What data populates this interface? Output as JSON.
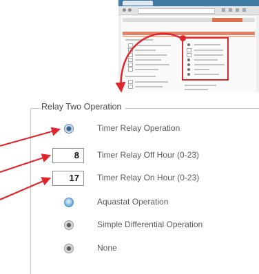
{
  "relay_two": {
    "legend": "Relay Two Operation",
    "options": [
      {
        "label": "Timer Relay Operation",
        "state": "selected"
      },
      {
        "label": "Timer Relay Off Hour (0-23)",
        "value": "8"
      },
      {
        "label": "Timer Relay On Hour (0-23)",
        "value": "17"
      },
      {
        "label": "Aquastat Operation",
        "state": "unselected"
      },
      {
        "label": "Simple Differential Operation",
        "state": "disabled"
      },
      {
        "label": "None",
        "state": "disabled"
      }
    ]
  },
  "colors": {
    "annotation_red": "#e0262d",
    "radio_blue": "#5d9fd2",
    "fieldset_border": "#c8c8c8"
  },
  "icons": [
    "radio-selected-icon",
    "radio-unselected-icon",
    "radio-disabled-icon",
    "annotation-arrow"
  ]
}
